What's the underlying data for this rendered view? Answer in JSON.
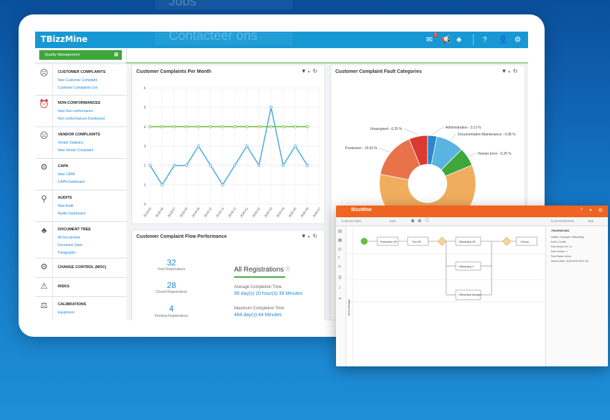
{
  "background_links": {
    "jobs": "Jobs",
    "contact": "Contacteer ons"
  },
  "app": {
    "logo": "BizzMine",
    "badge_count": "3",
    "module_button": "Quality Management"
  },
  "sidebar": {
    "groups": [
      {
        "icon": "sad-face-icon",
        "title": "CUSTOMER COMPLAINTS",
        "links": [
          "New Customer Complaint",
          "Customer Complaints List"
        ]
      },
      {
        "icon": "alarm-icon",
        "title": "NON-CONFORMANCES",
        "links": [
          "New Non-conformance",
          "Non-conformances Dashboard"
        ]
      },
      {
        "icon": "sad-face-icon",
        "title": "VENDOR COMPLAINTS",
        "links": [
          "Vendor Statistics",
          "New Vendor Complaint"
        ]
      },
      {
        "icon": "gears-icon",
        "title": "CAPA",
        "links": [
          "New CAPA",
          "CAPA Dashboard"
        ]
      },
      {
        "icon": "magnifier-icon",
        "title": "AUDITS",
        "links": [
          "New Audit",
          "Audits Dashboard"
        ]
      },
      {
        "icon": "tree-icon",
        "title": "DOCUMENT TREE",
        "links": [
          "All Documents",
          "Document Stats",
          "Paragraphs"
        ]
      },
      {
        "icon": "gears-icon",
        "title": "CHANGE CONTROL (MOC)",
        "links": []
      },
      {
        "icon": "warning-icon",
        "title": "RISKS",
        "links": []
      },
      {
        "icon": "scale-icon",
        "title": "CALIBRATIONS",
        "links": [
          "Equipment"
        ]
      }
    ]
  },
  "complaints_chart": {
    "panel_title": "Customer Complaints Per Month",
    "chart_data": {
      "type": "line",
      "categories": [
        "2019-05",
        "2019-06",
        "2019-07",
        "2019-08",
        "2019-09",
        "2019-10",
        "2019-11",
        "2019-12",
        "2020-01",
        "2020-02",
        "2020-03",
        "2020-04",
        "2020-05",
        "2020-06",
        "2020-07"
      ],
      "series": [
        {
          "values": [
            2,
            1,
            2,
            2,
            3,
            2,
            1,
            2,
            3,
            2,
            5,
            2,
            3,
            2
          ],
          "color": "#4aaee0"
        },
        {
          "values": [
            4,
            4,
            4,
            4,
            4,
            4,
            4,
            4,
            4,
            4,
            4,
            4,
            4,
            4
          ],
          "color": "#6dbb45"
        }
      ],
      "ylim": [
        0,
        6
      ],
      "yticks": [
        "0",
        "1",
        "2",
        "3",
        "4",
        "5",
        "6"
      ],
      "grid": true
    }
  },
  "fault_chart": {
    "panel_title": "Customer Complaint Fault Categories",
    "chart_data": {
      "type": "pie",
      "slices": [
        {
          "label": "Administration - 3.13 %",
          "value": 3.13,
          "color": "#2f86c9"
        },
        {
          "label": "Documentation Maintenance - 9.38 %",
          "value": 9.38,
          "color": "#5ab4e0"
        },
        {
          "label": "Human Error - 6.25 %",
          "value": 6.25,
          "color": "#3ea73a"
        },
        {
          "label": "",
          "value": 59.38,
          "color": "#f0ad5e"
        },
        {
          "label": "Production - 15.63 %",
          "value": 15.63,
          "color": "#e8734a"
        },
        {
          "label": "Unassigned - 6.25 %",
          "value": 6.25,
          "color": "#d93a32"
        }
      ]
    }
  },
  "flow_panel": {
    "title": "Customer Complaint Flow Performance",
    "stats": [
      {
        "value": "32",
        "label": "Total Registrations"
      },
      {
        "value": "28",
        "label": "Closed Registrations"
      },
      {
        "value": "4",
        "label": "Pending Registrations"
      }
    ],
    "all_registrations": "All Registrations",
    "avg_label": "Average Completion Time",
    "avg_value": "99 day(s) 20 hour(s) 39 Minutes",
    "max_label": "Maximum Completion Time",
    "max_value": "484 day(s) 44 Minutes"
  },
  "flow_editor": {
    "logo": "BizzMine",
    "toolbar": {
      "flow_settings": "FLOW SETTINGS",
      "save": "SAVE",
      "flow_properties": "FLOW PROPERTIES",
      "new": "NEW"
    },
    "properties_title": "PROPERTIES",
    "properties": [
      "Initiator: Employee Offboarding",
      "Action: Create",
      "Flow Version Nr: 14",
      "Flow Version: 1",
      "Flow Status: Active",
      "Version Date: 11/04/2019 09:57 am"
    ],
    "nodes": [
      "Preparation HR",
      "End HR",
      "Offboarding HR",
      "Closing",
      "Offboarding IT",
      "Offboarding Manager"
    ],
    "lane_label": "Direct Manager"
  }
}
